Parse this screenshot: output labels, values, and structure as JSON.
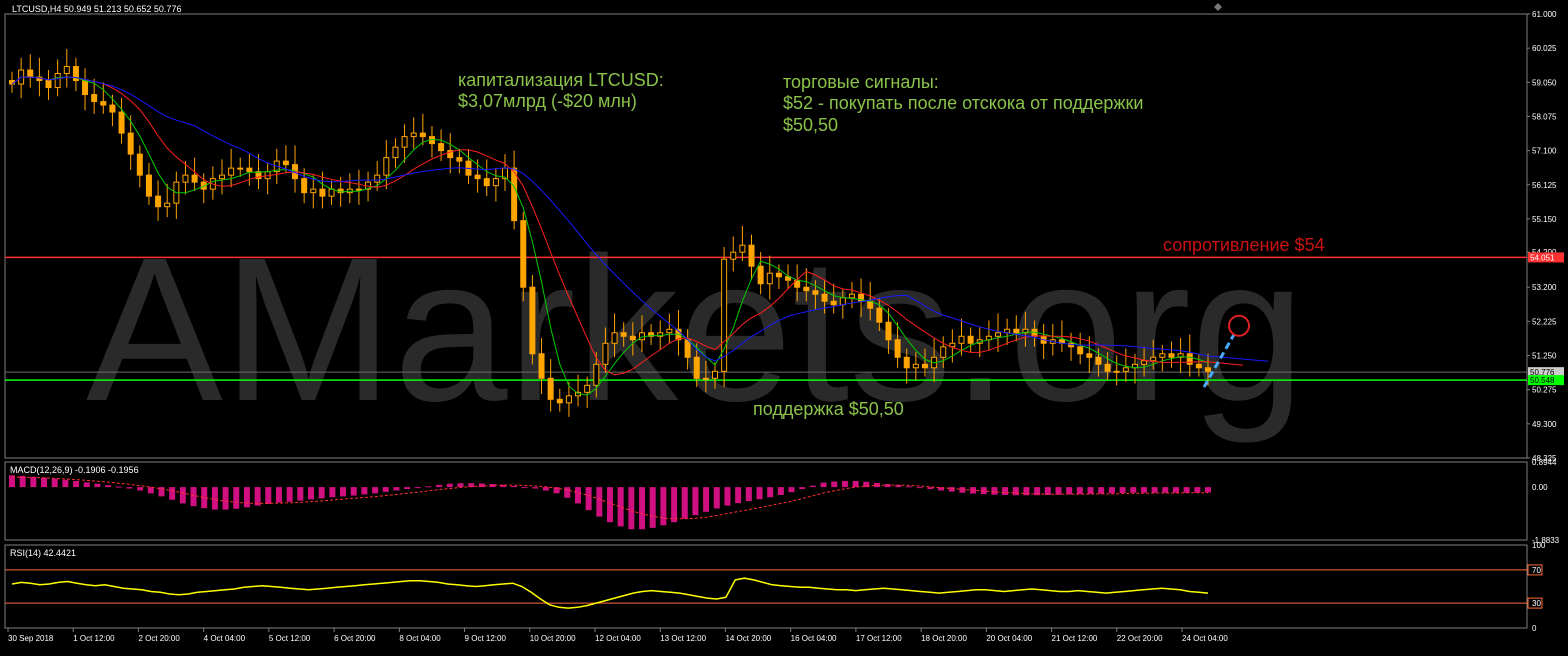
{
  "header": {
    "symbol_line": "LTCUSD,H4  50.949 51.213 50.652 50.776"
  },
  "watermark": "AMarkets.org",
  "annotations": {
    "cap_line1": "капитализация LTCUSD:",
    "cap_line2": "$3,07млрд (-$20 млн)",
    "signals_line1": "торговые сигналы:",
    "signals_line2": "$52 - покупать после отскока от поддержки",
    "signals_line3": "$50,50",
    "resistance_label": "сопротивление $54",
    "support_label": "поддержка $50,50"
  },
  "colors": {
    "background": "#000000",
    "grid": "#333333",
    "candle": "#ffa500",
    "ma_fast": "#00cc00",
    "ma_mid": "#ff2020",
    "ma_slow": "#1a1aff",
    "resistance": "#ff3030",
    "support": "#00ff00",
    "macd_hist": "#d01080",
    "rsi": "#ffff00",
    "annotation_green": "#8bc34a",
    "annotation_red": "#cc1111",
    "axis_text": "#ffffff"
  },
  "chart_data": [
    {
      "type": "candlestick",
      "title": "LTCUSD,H4",
      "ohlc_last": {
        "open": 50.949,
        "high": 51.213,
        "low": 50.652,
        "close": 50.776
      },
      "ylim": [
        48.325,
        61.0
      ],
      "y_ticks": [
        "61.000",
        "60.025",
        "59.050",
        "58.075",
        "57.100",
        "56.125",
        "55.150",
        "54.200",
        "53.200",
        "52.225",
        "51.250",
        "50.275",
        "49.300",
        "48.325"
      ],
      "closes": [
        59.0,
        59.4,
        59.2,
        59.1,
        58.9,
        59.3,
        59.5,
        59.1,
        58.7,
        58.5,
        58.4,
        58.2,
        57.6,
        57.0,
        56.4,
        55.8,
        55.5,
        55.6,
        56.2,
        56.4,
        56.2,
        56.0,
        56.3,
        56.4,
        56.6,
        56.6,
        56.5,
        56.3,
        56.5,
        56.8,
        56.7,
        56.3,
        55.9,
        56.0,
        55.8,
        56.0,
        55.9,
        56.0,
        56.0,
        56.2,
        56.4,
        56.9,
        57.2,
        57.5,
        57.6,
        57.5,
        57.3,
        57.1,
        56.9,
        56.8,
        56.4,
        56.3,
        56.1,
        56.3,
        56.6,
        55.1,
        53.2,
        51.3,
        50.6,
        50.0,
        49.9,
        50.1,
        50.2,
        50.4,
        51.0,
        51.6,
        51.9,
        51.8,
        51.7,
        51.9,
        51.8,
        51.9,
        52.0,
        51.7,
        51.2,
        50.6,
        50.6,
        50.8,
        54.0,
        54.2,
        54.4,
        53.8,
        53.3,
        53.6,
        53.5,
        53.4,
        53.2,
        53.1,
        53.0,
        52.8,
        52.7,
        52.9,
        53.0,
        52.8,
        52.6,
        52.2,
        51.7,
        51.2,
        50.9,
        51.0,
        50.9,
        51.2,
        51.5,
        51.6,
        51.8,
        51.6,
        51.7,
        51.8,
        51.9,
        52.0,
        51.9,
        52.0,
        51.8,
        51.6,
        51.7,
        51.6,
        51.5,
        51.3,
        51.2,
        51.0,
        50.8,
        50.8,
        50.9,
        51.0,
        51.1,
        51.2,
        51.3,
        51.2,
        51.3,
        51.0,
        50.9,
        50.8
      ],
      "resistance": 54.051,
      "support": 50.548,
      "price_markers": [
        "54.051",
        "50.776",
        "50.548"
      ],
      "moving_averages": [
        "fast",
        "mid",
        "slow"
      ]
    },
    {
      "type": "histogram",
      "title": "MACD(12,26,9) -0.1906 -0.1956",
      "y_ticks": [
        "0.8944",
        "0.00",
        "-1.8833"
      ],
      "ylim": [
        -1.8833,
        0.8944
      ],
      "values": [
        0.42,
        0.4,
        0.37,
        0.34,
        0.3,
        0.26,
        0.22,
        0.17,
        0.12,
        0.07,
        0.02,
        -0.05,
        -0.12,
        -0.22,
        -0.33,
        -0.45,
        -0.58,
        -0.68,
        -0.75,
        -0.8,
        -0.8,
        -0.77,
        -0.72,
        -0.66,
        -0.6,
        -0.55,
        -0.52,
        -0.48,
        -0.44,
        -0.4,
        -0.36,
        -0.33,
        -0.3,
        -0.26,
        -0.22,
        -0.17,
        -0.12,
        -0.07,
        -0.02,
        0.03,
        0.08,
        0.12,
        0.14,
        0.14,
        0.13,
        0.11,
        0.08,
        0.04,
        0.0,
        -0.05,
        -0.12,
        -0.22,
        -0.38,
        -0.58,
        -0.82,
        -1.05,
        -1.25,
        -1.4,
        -1.5,
        -1.5,
        -1.45,
        -1.36,
        -1.25,
        -1.12,
        -1.0,
        -0.88,
        -0.76,
        -0.66,
        -0.57,
        -0.5,
        -0.43,
        -0.36,
        -0.28,
        -0.18,
        -0.07,
        0.05,
        0.16,
        0.2,
        0.22,
        0.22,
        0.19,
        0.15,
        0.11,
        0.07,
        0.03,
        -0.02,
        -0.07,
        -0.12,
        -0.16,
        -0.2,
        -0.23,
        -0.25,
        -0.27,
        -0.28,
        -0.29,
        -0.29,
        -0.29,
        -0.28,
        -0.27,
        -0.26,
        -0.25,
        -0.24,
        -0.23,
        -0.22,
        -0.21,
        -0.2,
        -0.2,
        -0.2,
        -0.2,
        -0.2,
        -0.2,
        -0.2,
        -0.19
      ],
      "signal": [
        0.35,
        0.35,
        0.34,
        0.33,
        0.31,
        0.29,
        0.27,
        0.24,
        0.21,
        0.18,
        0.14,
        0.1,
        0.05,
        0.0,
        -0.06,
        -0.13,
        -0.21,
        -0.29,
        -0.37,
        -0.44,
        -0.5,
        -0.54,
        -0.57,
        -0.58,
        -0.58,
        -0.57,
        -0.56,
        -0.54,
        -0.52,
        -0.49,
        -0.46,
        -0.43,
        -0.4,
        -0.37,
        -0.34,
        -0.3,
        -0.26,
        -0.22,
        -0.18,
        -0.13,
        -0.09,
        -0.05,
        -0.01,
        0.02,
        0.04,
        0.06,
        0.07,
        0.07,
        0.06,
        0.04,
        0.01,
        -0.04,
        -0.1,
        -0.19,
        -0.3,
        -0.43,
        -0.57,
        -0.71,
        -0.84,
        -0.95,
        -1.04,
        -1.1,
        -1.13,
        -1.13,
        -1.11,
        -1.07,
        -1.01,
        -0.94,
        -0.87,
        -0.8,
        -0.73,
        -0.66,
        -0.58,
        -0.5,
        -0.41,
        -0.31,
        -0.21,
        -0.13,
        -0.06,
        0.0,
        0.04,
        0.06,
        0.07,
        0.07,
        0.06,
        0.04,
        0.01,
        -0.02,
        -0.05,
        -0.08,
        -0.11,
        -0.14,
        -0.17,
        -0.19,
        -0.21,
        -0.23,
        -0.24,
        -0.25,
        -0.25,
        -0.25,
        -0.25,
        -0.25,
        -0.24,
        -0.24,
        -0.23,
        -0.22,
        -0.22,
        -0.21,
        -0.21,
        -0.21,
        -0.2,
        -0.2,
        -0.2
      ]
    },
    {
      "type": "line",
      "title": "RSI(14) 42.4421",
      "y_ticks": [
        "100",
        "70",
        "30",
        "0"
      ],
      "ylim": [
        0,
        100
      ],
      "levels": [
        70,
        30
      ],
      "values": [
        53,
        55,
        54,
        52,
        53,
        55,
        56,
        54,
        52,
        51,
        52,
        50,
        48,
        47,
        46,
        44,
        43,
        41,
        40,
        41,
        43,
        44,
        45,
        46,
        47,
        49,
        50,
        51,
        50,
        49,
        48,
        47,
        46,
        47,
        48,
        49,
        50,
        51,
        52,
        53,
        54,
        55,
        56,
        57,
        57,
        56,
        55,
        53,
        52,
        51,
        50,
        51,
        52,
        53,
        54,
        50,
        43,
        35,
        28,
        25,
        24,
        25,
        27,
        30,
        33,
        36,
        39,
        42,
        44,
        45,
        44,
        43,
        42,
        40,
        38,
        36,
        35,
        37,
        58,
        60,
        58,
        55,
        52,
        51,
        50,
        49,
        49,
        48,
        47,
        46,
        46,
        45,
        46,
        47,
        48,
        47,
        46,
        45,
        44,
        43,
        42,
        43,
        44,
        45,
        46,
        46,
        45,
        44,
        45,
        46,
        47,
        46,
        45,
        44,
        44,
        45,
        44,
        43,
        42,
        43,
        44,
        45,
        46,
        47,
        48,
        47,
        46,
        44,
        43,
        42
      ],
      "last": 42.4421
    }
  ],
  "x_axis_labels": [
    "30 Sep 2018",
    "1 Oct 12:00",
    "2 Oct 20:00",
    "4 Oct 04:00",
    "5 Oct 12:00",
    "6 Oct 20:00",
    "8 Oct 04:00",
    "9 Oct 12:00",
    "10 Oct 20:00",
    "12 Oct 04:00",
    "13 Oct 12:00",
    "14 Oct 20:00",
    "16 Oct 04:00",
    "17 Oct 12:00",
    "18 Oct 20:00",
    "20 Oct 04:00",
    "21 Oct 12:00",
    "22 Oct 20:00",
    "24 Oct 04:00"
  ]
}
